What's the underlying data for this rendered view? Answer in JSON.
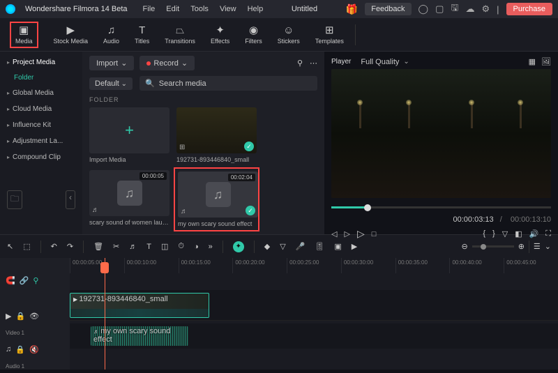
{
  "app": {
    "name": "Wondershare Filmora 14 Beta",
    "title": "Untitled"
  },
  "menu": [
    "File",
    "Edit",
    "Tools",
    "View",
    "Help"
  ],
  "titlebar": {
    "feedback": "Feedback",
    "purchase": "Purchase"
  },
  "tools": [
    {
      "label": "Media",
      "active": true
    },
    {
      "label": "Stock Media"
    },
    {
      "label": "Audio"
    },
    {
      "label": "Titles"
    },
    {
      "label": "Transitions"
    },
    {
      "label": "Effects"
    },
    {
      "label": "Filters"
    },
    {
      "label": "Stickers"
    },
    {
      "label": "Templates"
    }
  ],
  "sidebar": {
    "items": [
      "Project Media",
      "Global Media",
      "Cloud Media",
      "Influence Kit",
      "Adjustment La...",
      "Compound Clip"
    ],
    "folder": "Folder"
  },
  "media_panel": {
    "import": "Import",
    "record": "Record",
    "default": "Default",
    "search_placeholder": "Search media",
    "folder_label": "FOLDER",
    "items": [
      {
        "label": "Import Media",
        "type": "import"
      },
      {
        "label": "192731-893446840_small",
        "type": "video",
        "checked": true
      },
      {
        "label": "scary sound of women laug...",
        "type": "audio",
        "duration": "00:00:05"
      },
      {
        "label": "my own scary sound effect",
        "type": "audio",
        "duration": "00:02:04",
        "checked": true,
        "highlighted": true
      }
    ]
  },
  "preview": {
    "player": "Player",
    "quality": "Full Quality",
    "current_time": "00:00:03:13",
    "total_time": "00:00:13:10"
  },
  "timeline": {
    "ticks": [
      "00:00:05:00",
      "00:00:10:00",
      "00:00:15:00",
      "00:00:20:00",
      "00:00:25:00",
      "00:00:30:00",
      "00:00:35:00",
      "00:00:40:00",
      "00:00:45:00"
    ],
    "tracks": {
      "video1": {
        "label": "Video 1",
        "clip": "192731-893446840_small"
      },
      "audio1": {
        "label": "Audio 1",
        "clip": "my own scary sound effect"
      }
    }
  }
}
